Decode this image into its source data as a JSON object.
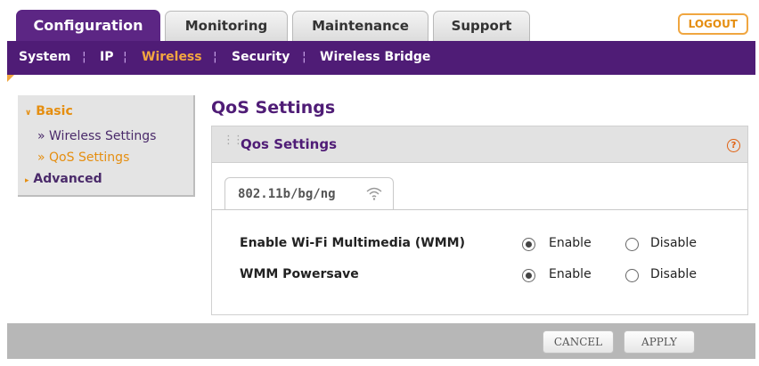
{
  "tabs": {
    "configuration": "Configuration",
    "monitoring": "Monitoring",
    "maintenance": "Maintenance",
    "support": "Support",
    "logout": "LOGOUT"
  },
  "subnav": {
    "system": "System",
    "ip": "IP",
    "wireless": "Wireless",
    "security": "Security",
    "wireless_bridge": "Wireless Bridge",
    "separator": "¦"
  },
  "sidebar": {
    "basic": "Basic",
    "wireless_settings": "» Wireless Settings",
    "qos_settings": "» QoS Settings",
    "advanced": "Advanced"
  },
  "page_title": "QoS Settings",
  "panel": {
    "title": "Qos Settings",
    "help": "?",
    "mode_tab": "802.11b/bg/ng"
  },
  "settings": {
    "wmm_label": "Enable Wi-Fi Multimedia (WMM)",
    "wmm_value": "Enable",
    "powersave_label": "WMM Powersave",
    "powersave_value": "Enable",
    "enable": "Enable",
    "disable": "Disable"
  },
  "footer": {
    "cancel": "CANCEL",
    "apply": "APPLY"
  },
  "colors": {
    "brand_purple": "#4f1c76",
    "accent_orange": "#e58e10"
  }
}
